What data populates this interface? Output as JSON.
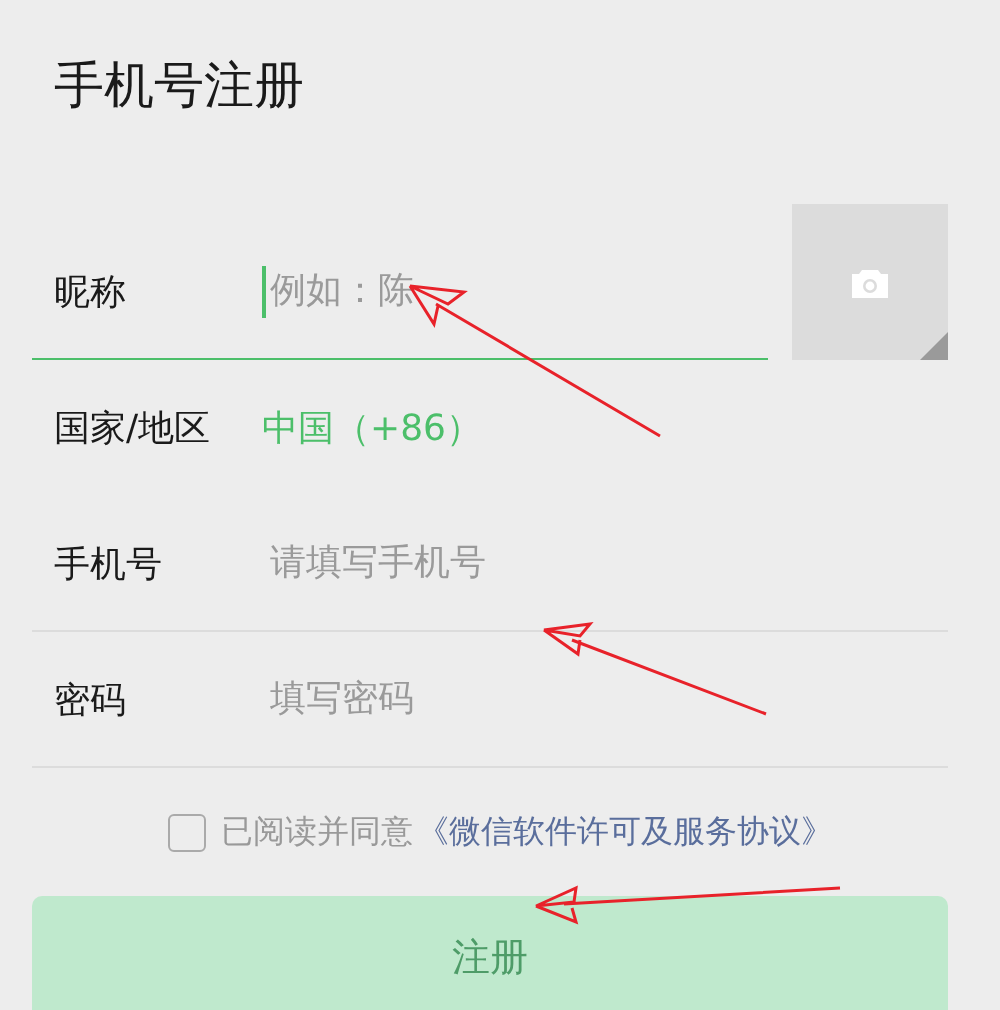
{
  "title": "手机号注册",
  "fields": [
    {
      "kind": "input",
      "label": "昵称",
      "placeholder": "例如：陈",
      "focused": true
    },
    {
      "kind": "select",
      "label": "国家/地区",
      "value": "中国（+86）"
    },
    {
      "kind": "input",
      "label": "手机号",
      "placeholder": "请填写手机号",
      "focused": false
    },
    {
      "kind": "input",
      "label": "密码",
      "placeholder": "填写密码",
      "focused": false
    }
  ],
  "agreement": {
    "checked": false,
    "text": "已阅读并同意",
    "link": "《微信软件许可及服务协议》"
  },
  "submit": {
    "label": "注册",
    "disabled": true
  }
}
